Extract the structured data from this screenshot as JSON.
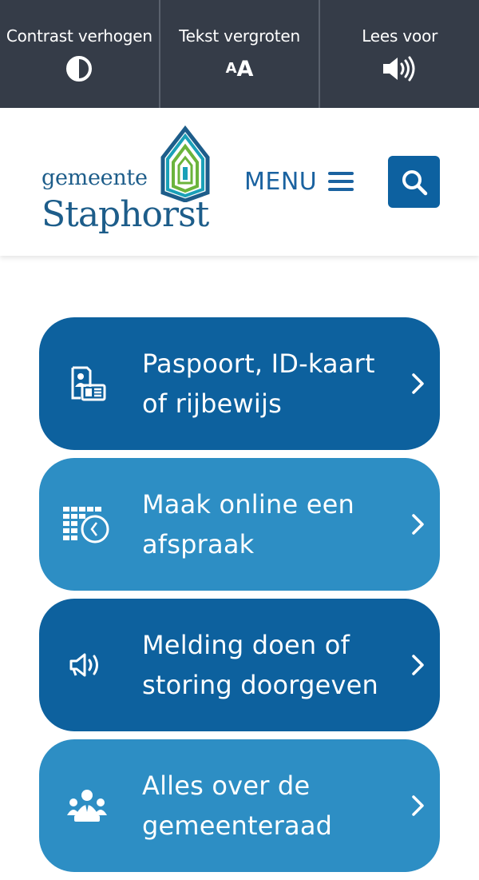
{
  "toolbar": {
    "contrast_label": "Contrast verhogen",
    "text_size_label": "Tekst vergroten",
    "text_size_icon_small": "A",
    "text_size_icon_big": "A",
    "read_aloud_label": "Lees voor",
    "icons": [
      "contrast-icon",
      "text-size-icon",
      "speaker-icon"
    ]
  },
  "header": {
    "logo_line1": "gemeente",
    "logo_line2": "Staphorst",
    "menu_label": "MENU",
    "search_icon": "search-icon"
  },
  "tiles": [
    {
      "line1": "Paspoort, ID-kaart",
      "line2": "of rijbewijs",
      "icon": "id-card-icon",
      "style": "dark"
    },
    {
      "line1": "Maak online een",
      "line2": "afspraak",
      "icon": "calendar-clock-icon",
      "style": "light"
    },
    {
      "line1": "Melding doen of",
      "line2": "storing doorgeven",
      "icon": "megaphone-icon",
      "style": "dark"
    },
    {
      "line1": "Alles over de",
      "line2": "gemeenteraad",
      "icon": "council-icon",
      "style": "light"
    }
  ],
  "colors": {
    "toolbar_bg": "#353c48",
    "brand_blue": "#1d5d8a",
    "tile_dark": "#0d619e",
    "tile_light": "#2d8ec4",
    "logo_green": "#6bb43c",
    "logo_teal": "#1aa0b8"
  }
}
